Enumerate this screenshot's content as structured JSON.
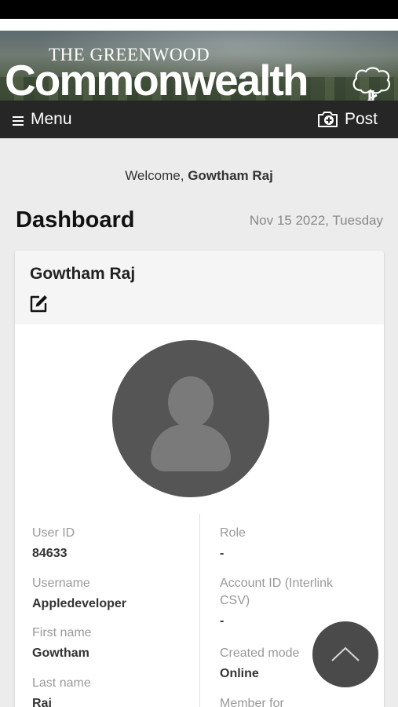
{
  "masthead": {
    "top_text": "THE GREENWOOD",
    "main_text": "Commonwealth"
  },
  "navbar": {
    "menu_label": "Menu",
    "menu_icon": "hamburger-icon",
    "post_label": "Post",
    "post_icon": "camera-plus-icon"
  },
  "welcome": {
    "prefix": "Welcome, ",
    "name": "Gowtham Raj"
  },
  "dashboard": {
    "title": "Dashboard",
    "date": "Nov 15 2022, Tuesday"
  },
  "profile": {
    "name": "Gowtham Raj",
    "edit_icon": "edit-icon",
    "avatar_icon": "user-avatar-icon",
    "left_fields": [
      {
        "label": "User ID",
        "value": "84633"
      },
      {
        "label": "Username",
        "value": "Appledeveloper"
      },
      {
        "label": "First name",
        "value": "Gowtham"
      },
      {
        "label": "Last name",
        "value": "Raj"
      }
    ],
    "right_fields": [
      {
        "label": "Role",
        "value": "-"
      },
      {
        "label": "Account ID (Interlink CSV)",
        "value": "-"
      },
      {
        "label": "Created mode",
        "value": "Online"
      },
      {
        "label": "Member for",
        "value": ""
      }
    ]
  },
  "scroll_top": {
    "icon": "chevron-up-icon"
  },
  "colors": {
    "navbar": "#262626",
    "page_background": "#ececec",
    "card_header": "#f5f5f5",
    "avatar_bg": "#555555",
    "scroll_button": "#4a4a4a"
  }
}
